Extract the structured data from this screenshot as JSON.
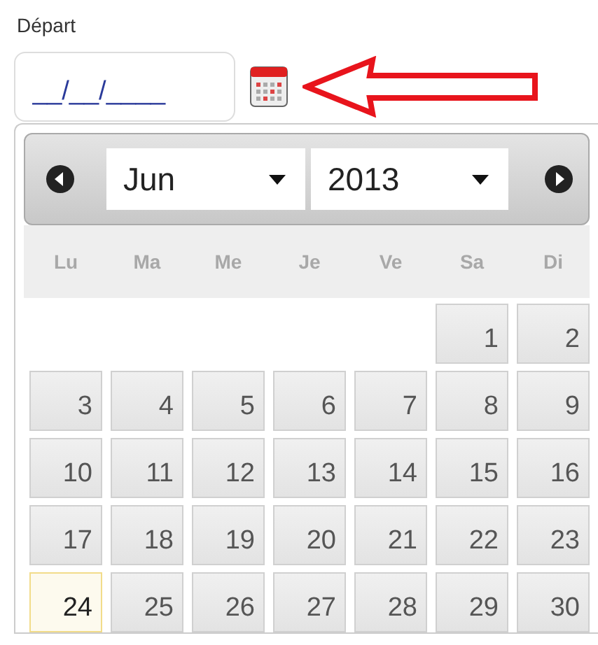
{
  "field": {
    "label": "Départ",
    "placeholder": "__/__/____"
  },
  "datepicker": {
    "month": "Jun",
    "year": "2013",
    "weekdays": [
      "Lu",
      "Ma",
      "Me",
      "Je",
      "Ve",
      "Sa",
      "Di"
    ],
    "weeks": [
      [
        {
          "day": "1",
          "today": false
        },
        {
          "day": "2",
          "today": false
        }
      ],
      [
        {
          "day": "3",
          "today": false
        },
        {
          "day": "4",
          "today": false
        },
        {
          "day": "5",
          "today": false
        },
        {
          "day": "6",
          "today": false
        },
        {
          "day": "7",
          "today": false
        },
        {
          "day": "8",
          "today": false
        },
        {
          "day": "9",
          "today": false
        }
      ],
      [
        {
          "day": "10",
          "today": false
        },
        {
          "day": "11",
          "today": false
        },
        {
          "day": "12",
          "today": false
        },
        {
          "day": "13",
          "today": false
        },
        {
          "day": "14",
          "today": false
        },
        {
          "day": "15",
          "today": false
        },
        {
          "day": "16",
          "today": false
        }
      ],
      [
        {
          "day": "17",
          "today": false
        },
        {
          "day": "18",
          "today": false
        },
        {
          "day": "19",
          "today": false
        },
        {
          "day": "20",
          "today": false
        },
        {
          "day": "21",
          "today": false
        },
        {
          "day": "22",
          "today": false
        },
        {
          "day": "23",
          "today": false
        }
      ],
      [
        {
          "day": "24",
          "today": true
        },
        {
          "day": "25",
          "today": false
        },
        {
          "day": "26",
          "today": false
        },
        {
          "day": "27",
          "today": false
        },
        {
          "day": "28",
          "today": false
        },
        {
          "day": "29",
          "today": false
        },
        {
          "day": "30",
          "today": false
        }
      ]
    ]
  }
}
